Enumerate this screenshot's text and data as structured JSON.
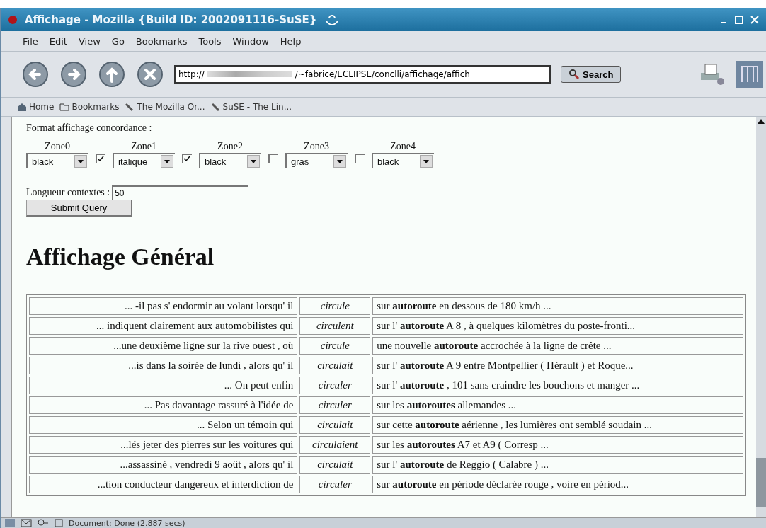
{
  "window": {
    "title": "Affichage - Mozilla {Build ID: 2002091116-SuSE}"
  },
  "menu": [
    "File",
    "Edit",
    "View",
    "Go",
    "Bookmarks",
    "Tools",
    "Window",
    "Help"
  ],
  "url_field": {
    "prefix": "http://",
    "suffix": "/~fabrice/ECLIPSE/conclli/affichage/affich"
  },
  "search_button": "Search",
  "personal_bar": [
    {
      "kind": "home",
      "label": "Home"
    },
    {
      "kind": "folder",
      "label": "Bookmarks"
    },
    {
      "kind": "link",
      "label": "The Mozilla Or..."
    },
    {
      "kind": "link",
      "label": "SuSE - The Lin..."
    }
  ],
  "form": {
    "title": "Format affichage concordance :",
    "zones": [
      {
        "label": "Zone0",
        "value": "black"
      },
      {
        "label": "Zone1",
        "value": "italique"
      },
      {
        "label": "Zone2",
        "value": "black"
      },
      {
        "label": "Zone3",
        "value": "gras"
      },
      {
        "label": "Zone4",
        "value": "black"
      }
    ],
    "checkboxes": [
      {
        "checked": true
      },
      {
        "checked": true
      },
      {
        "checked": false
      },
      {
        "checked": false
      }
    ],
    "length_label": "Longueur contextes :",
    "length_value": "50",
    "submit": "Submit Query"
  },
  "heading": "Affichage Général",
  "rows": [
    {
      "left": "... -il pas s' endormir au volant lorsqu' il",
      "verb": "circule",
      "right": "sur **autoroute** en dessous de 180 km/h  ..."
    },
    {
      "left": "... indiquent clairement aux automobilistes qui",
      "verb": "circulent",
      "right": "sur l' **autoroute** A 8 , à quelques kilomètres du poste-fronti..."
    },
    {
      "left": "...une deuxième ligne sur la rive ouest , où",
      "verb": "circule",
      "right": "une nouvelle **autoroute** accrochée à la ligne de crête  ..."
    },
    {
      "left": "...is dans la soirée de lundi , alors qu' il",
      "verb": "circulait",
      "right": "sur l' **autoroute** A 9 entre Montpellier ( Hérault ) et Roque..."
    },
    {
      "left": "... On peut enfin",
      "verb": "circuler",
      "right": "sur l' **autoroute** , 101 sans craindre les bouchons et manger ..."
    },
    {
      "left": "... Pas davantage rassuré à l'idée de",
      "verb": "circuler",
      "right": "sur les **autoroutes** allemandes  ..."
    },
    {
      "left": "... Selon un témoin qui",
      "verb": "circulait",
      "right": "sur cette **autoroute** aérienne , les lumières ont semblé soudain ..."
    },
    {
      "left": "...lés jeter des pierres sur les voitures qui",
      "verb": "circulaient",
      "right": "sur les **autoroutes** A7 et A9 ( Corresp  ..."
    },
    {
      "left": "...assassiné , vendredi 9 août , alors qu' il",
      "verb": "circulait",
      "right": "sur l' **autoroute** de Reggio ( Calabre )  ..."
    },
    {
      "left": "...tion conducteur dangereux et interdiction de",
      "verb": "circuler",
      "right": "sur **autoroute** en période déclarée rouge , voire en périod..."
    }
  ],
  "status_bar": {
    "text": "Document: Done (2.887 secs)"
  }
}
